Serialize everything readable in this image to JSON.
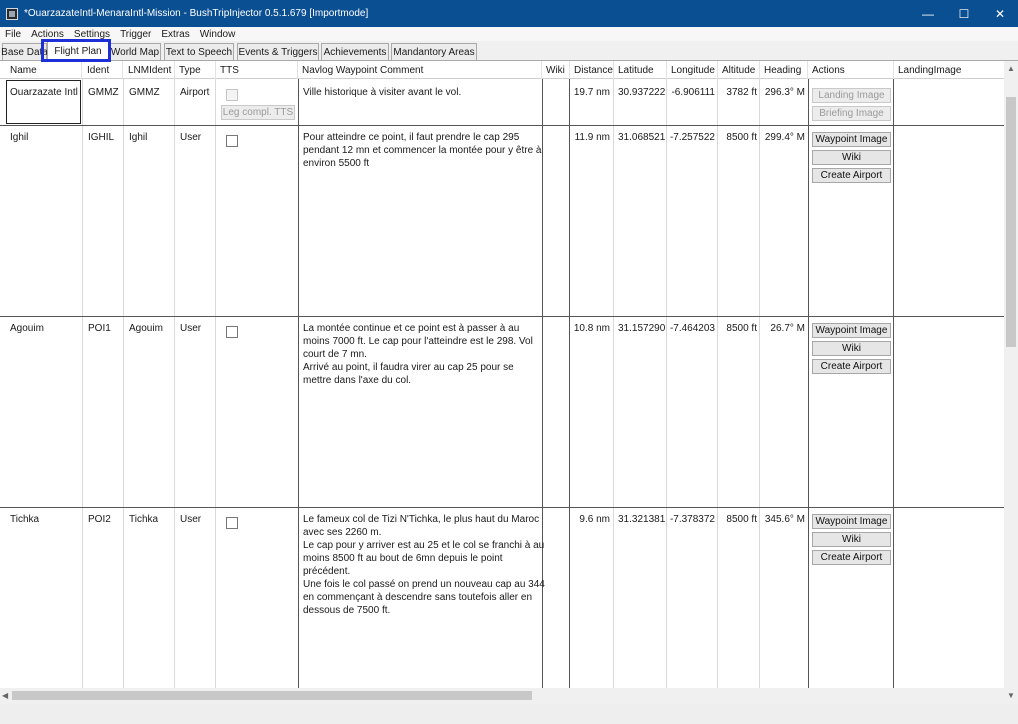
{
  "window": {
    "title": "*OuarzazateIntl-MenaraIntl-Mission - BushTripInjector 0.5.1.679 [Importmode]",
    "minimize": "—",
    "maximize": "☐",
    "close": "✕"
  },
  "menu": [
    "File",
    "Actions",
    "Settings",
    "Trigger",
    "Extras",
    "Window"
  ],
  "tabs": [
    "Base Data",
    "Flight Plan",
    "World Map",
    "Text to Speech",
    "Events & Triggers",
    "Achievements",
    "Mandantory Areas"
  ],
  "active_tab": "Flight Plan",
  "columns": [
    "Name",
    "Ident",
    "LNMIdent",
    "Type",
    "TTS",
    "Navlog Waypoint Comment",
    "Wiki",
    "Distance",
    "Latitude",
    "Longitude",
    "Altitude",
    "Heading",
    "Actions",
    "LandingImage"
  ],
  "rows": [
    {
      "name": "Ouarzazate Intl",
      "ident": "GMMZ",
      "lnmident": "GMMZ",
      "type": "Airport",
      "tts_button": "Leg compl. TTS",
      "comment": [
        "Ville historique à visiter avant le vol."
      ],
      "distance": "19.7 nm",
      "latitude": "30.937222",
      "longitude": "-6.906111",
      "altitude": "3782 ft",
      "heading": "296.3° M",
      "actions": [
        "Landing Image",
        "Briefing Image"
      ]
    },
    {
      "name": "Ighil",
      "ident": "IGHIL",
      "lnmident": "Ighil",
      "type": "User",
      "comment": [
        "Pour atteindre ce point, il faut prendre le cap 295",
        "pendant 12 mn et commencer la montée pour y être à",
        "environ 5500 ft"
      ],
      "distance": "11.9 nm",
      "latitude": "31.068521",
      "longitude": "-7.257522",
      "altitude": "8500 ft",
      "heading": "299.4° M",
      "actions": [
        "Waypoint Image",
        "Wiki",
        "Create Airport"
      ]
    },
    {
      "name": "Agouim",
      "ident": "POI1",
      "lnmident": "Agouim",
      "type": "User",
      "comment": [
        "La montée continue et ce point est à passer à au",
        "moins 7000 ft. Le cap pour l'atteindre est le 298. Vol",
        "court de 7 mn.",
        "Arrivé au point, il faudra virer au cap 25 pour se",
        "mettre dans l'axe du col."
      ],
      "distance": "10.8 nm",
      "latitude": "31.157290",
      "longitude": "-7.464203",
      "altitude": "8500 ft",
      "heading": "26.7° M",
      "actions": [
        "Waypoint Image",
        "Wiki",
        "Create Airport"
      ]
    },
    {
      "name": "Tichka",
      "ident": "POI2",
      "lnmident": "Tichka",
      "type": "User",
      "comment": [
        "Le fameux col de Tizi N'Tichka, le plus haut du Maroc",
        "avec ses 2260 m.",
        "Le cap pour y arriver est au 25 et le col se franchi à au",
        "moins 8500 ft au bout de 6mn depuis le point",
        "précédent.",
        "Une fois le col passé on prend un nouveau cap au 344",
        "en commençant à descendre sans toutefois aller en",
        "dessous de 7500 ft."
      ],
      "distance": "9.6 nm",
      "latitude": "31.321381",
      "longitude": "-7.378372",
      "altitude": "8500 ft",
      "heading": "345.6° M",
      "actions": [
        "Waypoint Image",
        "Wiki",
        "Create Airport"
      ]
    }
  ]
}
